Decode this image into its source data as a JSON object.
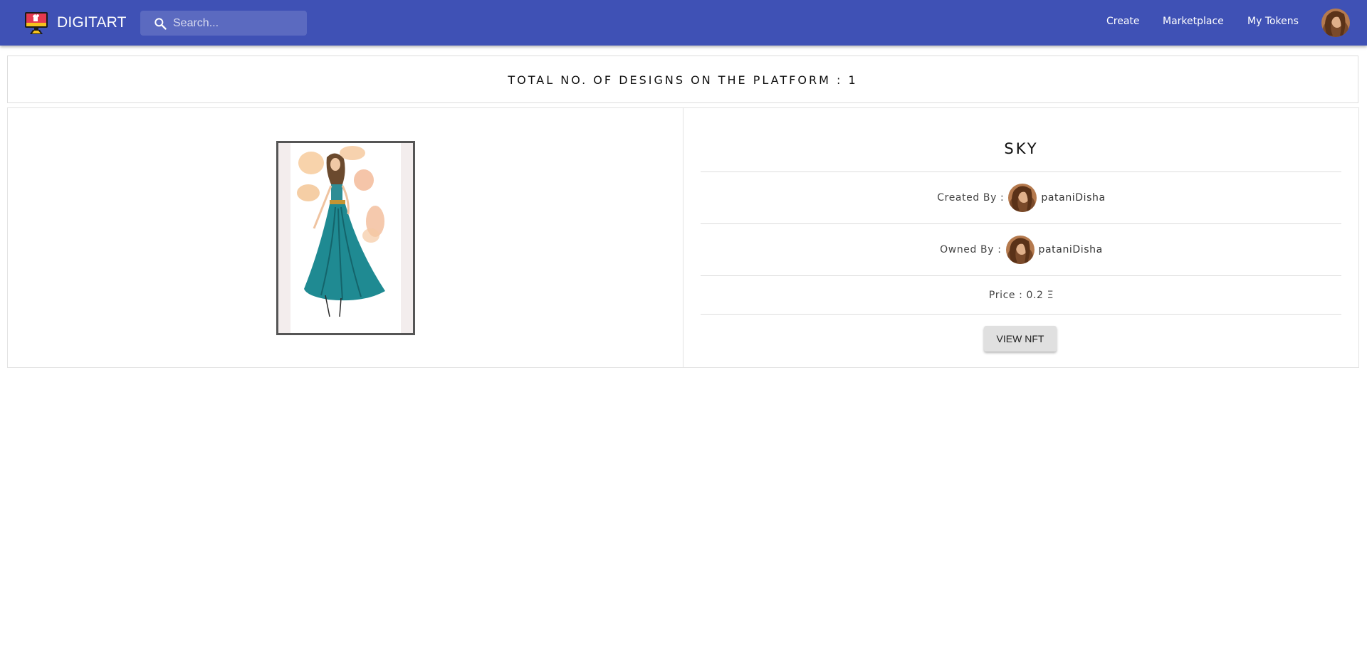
{
  "navbar": {
    "brand": "DIGITART",
    "search": {
      "placeholder": "Search..."
    },
    "links": {
      "create": "Create",
      "marketplace": "Marketplace",
      "my_tokens": "My Tokens"
    }
  },
  "summary": {
    "text": "TOTAL NO. OF DESIGNS ON THE PLATFORM : 1"
  },
  "nft": {
    "title": "SKY",
    "created_label": "Created By :",
    "creator": "pataniDisha",
    "owned_label": "Owned By :",
    "owner": "pataniDisha",
    "price_text": "Price : 0.2 Ξ",
    "view_button": "VIEW NFT"
  },
  "colors": {
    "navbar": "#3f51b5",
    "button": "#e0e0e0"
  }
}
